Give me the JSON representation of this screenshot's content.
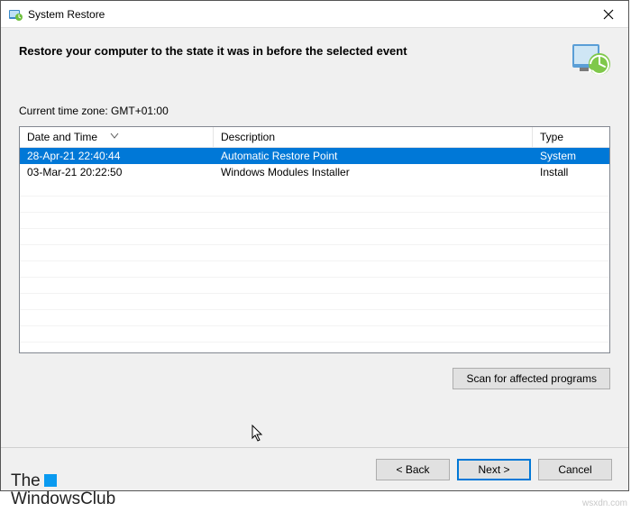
{
  "title": "System Restore",
  "heading": "Restore your computer to the state it was in before the selected event",
  "timezone_label": "Current time zone: GMT+01:00",
  "columns": {
    "c1": "Date and Time",
    "c2": "Description",
    "c3": "Type"
  },
  "rows": [
    {
      "dt": "28-Apr-21 22:40:44",
      "desc": "Automatic Restore Point",
      "type": "System",
      "selected": true
    },
    {
      "dt": "03-Mar-21 20:22:50",
      "desc": "Windows Modules Installer",
      "type": "Install",
      "selected": false
    }
  ],
  "buttons": {
    "scan": "Scan for affected programs",
    "back": "< Back",
    "next": "Next >",
    "cancel": "Cancel"
  },
  "logo": {
    "line1": "The",
    "line2": "WindowsClub"
  },
  "watermark": "wsxdn.com"
}
